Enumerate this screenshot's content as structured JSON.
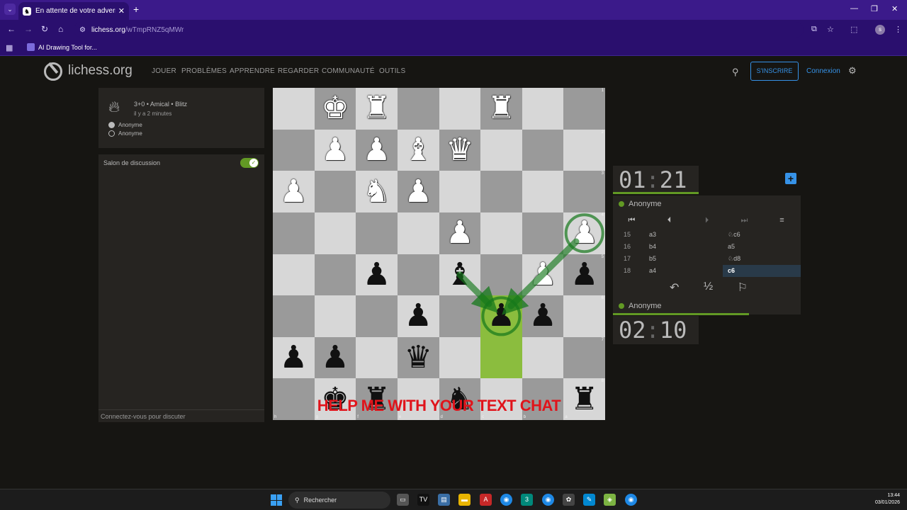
{
  "browser": {
    "tab_title": "En attente de votre adversaire",
    "url_host": "lichess.org",
    "url_path": "/wTmpRNZ5qMWr",
    "bookmark": "AI Drawing Tool for..."
  },
  "header": {
    "logo": "lichess.org",
    "nav": [
      "JOUER",
      "PROBLÈMES",
      "APPRENDRE",
      "REGARDER",
      "COMMUNAUTÉ",
      "OUTILS"
    ],
    "signup": "S'INSCRIRE",
    "login": "Connexion"
  },
  "game_info": {
    "setup": "3+0 • Amical • Blitz",
    "ago": "il y a 2 minutes",
    "player1": "Anonyme",
    "player2": "Anonyme"
  },
  "chat": {
    "title": "Salon de discussion",
    "footer": "Connectez-vous pour discuter"
  },
  "board": {
    "files": [
      "h",
      "g",
      "f",
      "e",
      "d",
      "c",
      "b",
      "a"
    ],
    "ranks": [
      "1",
      "2",
      "3",
      "4",
      "5",
      "6",
      "7",
      "8"
    ],
    "rows": [
      [
        "",
        "wK",
        "wR",
        "",
        "",
        "wR",
        "",
        ""
      ],
      [
        "",
        "wP",
        "wP",
        "wB",
        "wQ",
        "",
        "",
        ""
      ],
      [
        "wP",
        "",
        "wN",
        "wP",
        "",
        "",
        "",
        ""
      ],
      [
        "",
        "",
        "",
        "",
        "wP",
        "",
        "",
        "wP"
      ],
      [
        "",
        "",
        "bP",
        "",
        "bB",
        "",
        "wP",
        "bP"
      ],
      [
        "",
        "",
        "",
        "bP",
        "",
        "bP",
        "bP",
        ""
      ],
      [
        "bP",
        "bP",
        "",
        "bQ",
        "",
        "",
        "",
        ""
      ],
      [
        "",
        "bK",
        "bR",
        "",
        "bN",
        "",
        "",
        "bR"
      ]
    ],
    "highlight": [
      [
        5,
        5
      ],
      [
        6,
        5
      ]
    ],
    "overlay_text": "HELP ME WITH YOUR TEXT CHAT"
  },
  "clocks": {
    "top": {
      "min": "01",
      "sec": "21"
    },
    "bottom": {
      "min": "02",
      "sec": "10"
    }
  },
  "players": {
    "top": "Anonyme",
    "bottom": "Anonyme"
  },
  "moves": [
    {
      "n": "15",
      "w": "a3",
      "b": "♘c6"
    },
    {
      "n": "16",
      "w": "b4",
      "b": "a5"
    },
    {
      "n": "17",
      "w": "b5",
      "b": "♘d8"
    },
    {
      "n": "18",
      "w": "a4",
      "b": "c6"
    }
  ],
  "actions": {
    "takeback": "↶",
    "draw": "½",
    "resign": "⚐"
  },
  "taskbar": {
    "search": "Rechercher",
    "time": "13:44",
    "date": "03/01/2026"
  },
  "colors": {
    "accent": "#629924",
    "link": "#3692e7",
    "overlay": "#e0141b"
  }
}
